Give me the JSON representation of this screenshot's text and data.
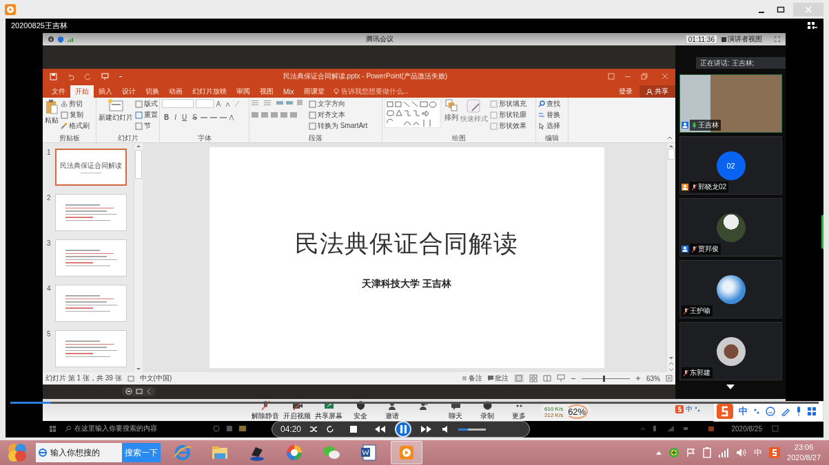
{
  "player": {
    "title": "20200825王吉林"
  },
  "meeting": {
    "title": "腾讯会议",
    "timer": "01:11:36",
    "view_button": "演讲者视图"
  },
  "ppt": {
    "title": "民法典保证合同解读.pptx - PowerPoint(产品激活失败)",
    "tabs": [
      {
        "label": "文件",
        "selected": false
      },
      {
        "label": "开始",
        "selected": true
      },
      {
        "label": "插入",
        "selected": false
      },
      {
        "label": "设计",
        "selected": false
      },
      {
        "label": "切换",
        "selected": false
      },
      {
        "label": "动画",
        "selected": false
      },
      {
        "label": "幻灯片放映",
        "selected": false
      },
      {
        "label": "审阅",
        "selected": false
      },
      {
        "label": "视图",
        "selected": false
      },
      {
        "label": "Mix",
        "selected": false
      },
      {
        "label": "雨课堂",
        "selected": false
      }
    ],
    "tell_me": "告诉我您想要做什么...",
    "login": "登录",
    "share": "共享",
    "ribbon": [
      {
        "name": "剪贴板",
        "kind": "clipboard",
        "items": [
          "粘贴",
          "剪切",
          "复制",
          "格式刷"
        ]
      },
      {
        "name": "幻灯片",
        "kind": "slides",
        "items": [
          "新建幻灯片",
          "版式",
          "重置",
          "节"
        ]
      },
      {
        "name": "字体",
        "kind": "font",
        "items": [
          "B",
          "I",
          "U",
          "S"
        ]
      },
      {
        "name": "段落",
        "kind": "paragraph",
        "items": [
          "文字方向",
          "对齐文本",
          "转换为 SmartArt"
        ]
      },
      {
        "name": "绘图",
        "kind": "drawing",
        "items": [
          "排列",
          "快速样式",
          "形状填充",
          "形状轮廓",
          "形状效果"
        ]
      },
      {
        "name": "编辑",
        "kind": "editing",
        "items": [
          "查找",
          "替换",
          "选择"
        ]
      }
    ],
    "thumbnails": [
      {
        "number": "1",
        "selected": true,
        "title": "民法典保证合同解读"
      },
      {
        "number": "2",
        "selected": false
      },
      {
        "number": "3",
        "selected": false
      },
      {
        "number": "4",
        "selected": false
      },
      {
        "number": "5",
        "selected": false
      }
    ],
    "slide": {
      "title": "民法典保证合同解读",
      "subtitle": "天津科技大学 王吉林"
    },
    "status": {
      "slide_info": "幻灯片 第 1 张，共 39 张",
      "language": "中文(中国)",
      "notes": "备注",
      "comments": "批注",
      "zoom": "63%",
      "zoom_slider": {
        "level": 0.45
      }
    }
  },
  "participants": {
    "speaking": "正在讲话: 王吉林;",
    "tiles": [
      {
        "name": "王吉林",
        "kind": "video",
        "muted": false,
        "color": "#1e6fe6"
      },
      {
        "name": "郭晓龙02",
        "kind": "initials",
        "initials": "02",
        "muted": true,
        "color": "#f08a24"
      },
      {
        "name": "贾邦俊",
        "kind": "photo",
        "muted": true,
        "color": "#1e6fe6"
      },
      {
        "name": "王护喻",
        "kind": "sky",
        "muted": true
      },
      {
        "name": "东郭建",
        "kind": "portrait",
        "muted": true
      }
    ]
  },
  "meeting_toolbar": [
    {
      "kind": "mic",
      "label": "解除静音"
    },
    {
      "kind": "video",
      "label": "开启视频"
    },
    {
      "kind": "share",
      "label": "共享屏幕"
    },
    {
      "kind": "security",
      "label": "安全"
    },
    {
      "kind": "invite",
      "label": "邀请"
    },
    {
      "kind": "members"
    },
    {
      "kind": "chat",
      "label": "聊天"
    },
    {
      "kind": "record",
      "label": "录制"
    },
    {
      "kind": "more",
      "label": "更多"
    }
  ],
  "network": {
    "up": "610 K/s",
    "down": "212 K/s",
    "percent": "62%"
  },
  "player_controls": {
    "time": "04:20",
    "progress": {
      "level": 0.05
    },
    "volume": {
      "level": 0.35
    }
  },
  "ime": {
    "small_mode": "中",
    "mode": "中"
  },
  "inner_taskbar": {
    "search_placeholder": "在这里输入你要搜索的内容",
    "date": "2020/8/25"
  },
  "taskbar": {
    "search_placeholder": "输入你想搜的",
    "search_button": "搜索一下",
    "apps": [
      {
        "kind": "ie",
        "active": false
      },
      {
        "kind": "folder",
        "active": false
      },
      {
        "kind": "laptop",
        "active": false
      },
      {
        "kind": "browser",
        "active": false
      },
      {
        "kind": "wechat",
        "active": false
      },
      {
        "kind": "word",
        "active": false
      },
      {
        "kind": "player",
        "active": true
      }
    ],
    "tray_ime": "中",
    "time": "23:06",
    "date": "2020/8/27"
  }
}
